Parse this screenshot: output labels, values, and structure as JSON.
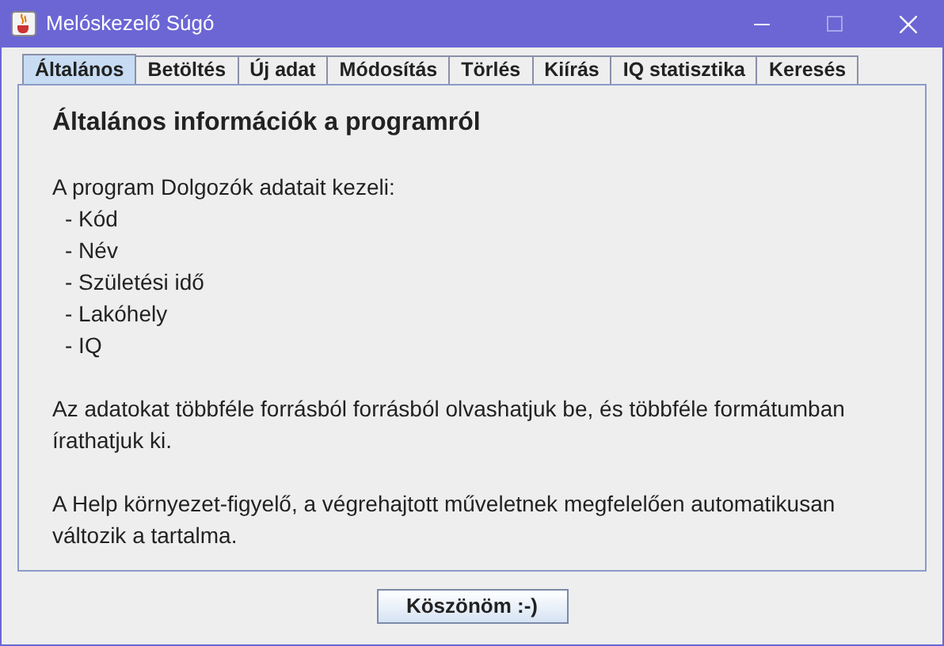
{
  "window": {
    "title": "Melóskezelő Súgó"
  },
  "tabs": [
    {
      "label": "Általános",
      "selected": true
    },
    {
      "label": "Betöltés",
      "selected": false
    },
    {
      "label": "Új adat",
      "selected": false
    },
    {
      "label": "Módosítás",
      "selected": false
    },
    {
      "label": "Törlés",
      "selected": false
    },
    {
      "label": "Kiírás",
      "selected": false
    },
    {
      "label": "IQ statisztika",
      "selected": false
    },
    {
      "label": "Keresés",
      "selected": false
    }
  ],
  "content": {
    "heading": "Általános információk a programról",
    "intro": "A program Dolgozók adatait kezeli:",
    "fields": [
      "- Kód",
      "- Név",
      "- Születési idő",
      "- Lakóhely",
      "- IQ"
    ],
    "paragraphs": [
      "Az adatokat többféle forrásból forrásból olvashatjuk be, és többféle formátumban írathatjuk ki.",
      "A Help környezet-figyelő, a végrehajtott műveletnek megfelelően automatikusan változik a tartalma."
    ]
  },
  "button": "Köszönöm :-)"
}
